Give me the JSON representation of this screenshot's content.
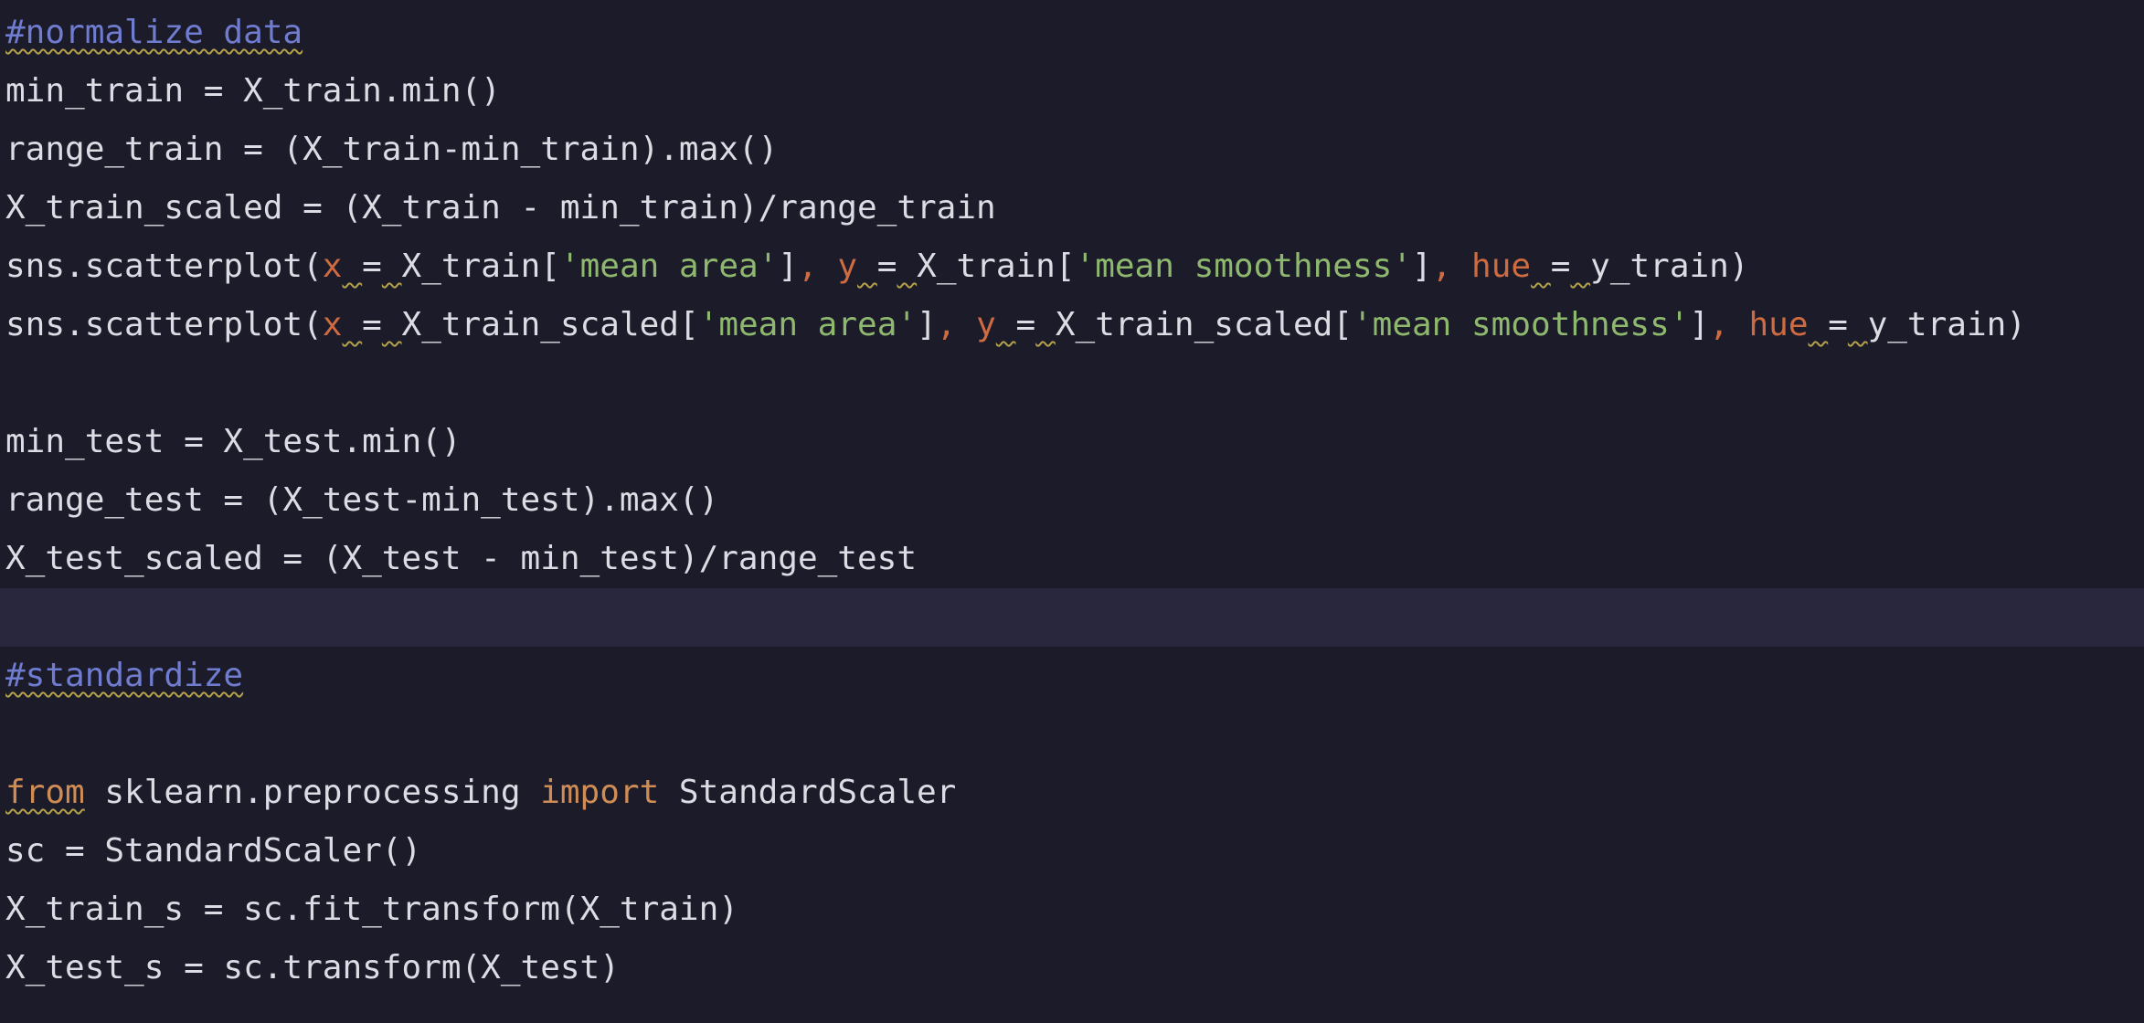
{
  "editor": {
    "lines": [
      [
        {
          "t": "#normalize data",
          "c": "comment"
        }
      ],
      [
        {
          "t": "min_train = X_train.min()",
          "c": "plain"
        }
      ],
      [
        {
          "t": "range_train = (X_train-min_train).max()",
          "c": "plain"
        }
      ],
      [
        {
          "t": "X_train_scaled = (X_train - min_train)/range_train",
          "c": "plain"
        }
      ],
      [
        {
          "t": "sns.scatterplot(",
          "c": "plain"
        },
        {
          "t": "x",
          "c": "param"
        },
        {
          "t": " ",
          "c": "squig"
        },
        {
          "t": "=",
          "c": "plain"
        },
        {
          "t": " ",
          "c": "squig"
        },
        {
          "t": "X_train[",
          "c": "plain"
        },
        {
          "t": "'mean area'",
          "c": "string"
        },
        {
          "t": "]",
          "c": "plain"
        },
        {
          "t": ", ",
          "c": "orange-punct"
        },
        {
          "t": "y",
          "c": "param"
        },
        {
          "t": " ",
          "c": "squig"
        },
        {
          "t": "=",
          "c": "plain"
        },
        {
          "t": " ",
          "c": "squig"
        },
        {
          "t": "X_train[",
          "c": "plain"
        },
        {
          "t": "'mean smoothness'",
          "c": "string"
        },
        {
          "t": "]",
          "c": "plain"
        },
        {
          "t": ", ",
          "c": "orange-punct"
        },
        {
          "t": "hue",
          "c": "param"
        },
        {
          "t": " ",
          "c": "squig"
        },
        {
          "t": "=",
          "c": "plain"
        },
        {
          "t": " ",
          "c": "squig"
        },
        {
          "t": "y_train)",
          "c": "plain"
        }
      ],
      [
        {
          "t": "sns.scatterplot(",
          "c": "plain"
        },
        {
          "t": "x",
          "c": "param"
        },
        {
          "t": " ",
          "c": "squig"
        },
        {
          "t": "=",
          "c": "plain"
        },
        {
          "t": " ",
          "c": "squig"
        },
        {
          "t": "X_train_scaled[",
          "c": "plain"
        },
        {
          "t": "'mean area'",
          "c": "string"
        },
        {
          "t": "]",
          "c": "plain"
        },
        {
          "t": ", ",
          "c": "orange-punct"
        },
        {
          "t": "y",
          "c": "param"
        },
        {
          "t": " ",
          "c": "squig"
        },
        {
          "t": "=",
          "c": "plain"
        },
        {
          "t": " ",
          "c": "squig"
        },
        {
          "t": "X_train_scaled[",
          "c": "plain"
        },
        {
          "t": "'mean smoothness'",
          "c": "string"
        },
        {
          "t": "]",
          "c": "plain"
        },
        {
          "t": ", ",
          "c": "orange-punct"
        },
        {
          "t": "hue",
          "c": "param"
        },
        {
          "t": " ",
          "c": "squig"
        },
        {
          "t": "=",
          "c": "plain"
        },
        {
          "t": " ",
          "c": "squig"
        },
        {
          "t": "y_train)",
          "c": "plain"
        }
      ],
      [],
      [
        {
          "t": "min_test = X_test.min()",
          "c": "plain"
        }
      ],
      [
        {
          "t": "range_test = (X_test-min_test).max()",
          "c": "plain"
        }
      ],
      [
        {
          "t": "X_test_scaled = (X_test - min_test)/range_test",
          "c": "plain"
        }
      ],
      [],
      [
        {
          "t": "#standardize",
          "c": "comment"
        }
      ],
      [],
      [
        {
          "t": "from",
          "c": "kw-warn"
        },
        {
          "t": " sklearn.preprocessing ",
          "c": "plain"
        },
        {
          "t": "import",
          "c": "kw"
        },
        {
          "t": " StandardScaler",
          "c": "plain"
        }
      ],
      [
        {
          "t": "sc = StandardScaler()",
          "c": "plain"
        }
      ],
      [
        {
          "t": "X_train_s = sc.fit_transform(X_train)",
          "c": "plain"
        }
      ],
      [
        {
          "t": "X_test_s = sc.transform(X_test)",
          "c": "plain"
        }
      ]
    ],
    "current_line_index": 10
  }
}
